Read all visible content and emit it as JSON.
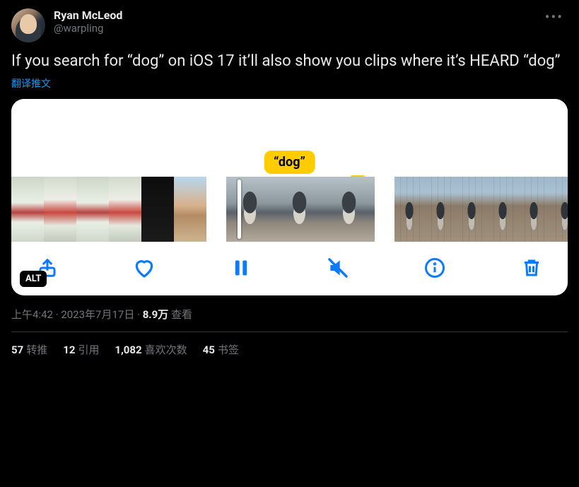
{
  "author": {
    "display_name": "Ryan McLeod",
    "handle": "@warpling"
  },
  "tweet_text": "If you search for “dog” on iOS 17 it’ll also show you clips where it’s HEARD “dog”",
  "translate_label": "翻译推文",
  "media": {
    "search_badge": "“dog”",
    "alt_badge": "ALT",
    "toolbar_icons": {
      "share": "share-icon",
      "like": "heart-icon",
      "pause": "pause-icon",
      "mute": "speaker-muted-icon",
      "info": "info-icon",
      "delete": "trash-icon"
    }
  },
  "meta": {
    "time": "上午4:42",
    "sep1": " · ",
    "date": "2023年7月17日",
    "sep2": " · ",
    "views_count": "8.9万",
    "views_label": " 查看"
  },
  "stats": {
    "retweets": {
      "count": "57",
      "label": "转推"
    },
    "quotes": {
      "count": "12",
      "label": "引用"
    },
    "likes": {
      "count": "1,082",
      "label": "喜欢次数"
    },
    "bookmarks": {
      "count": "45",
      "label": "书签"
    }
  }
}
